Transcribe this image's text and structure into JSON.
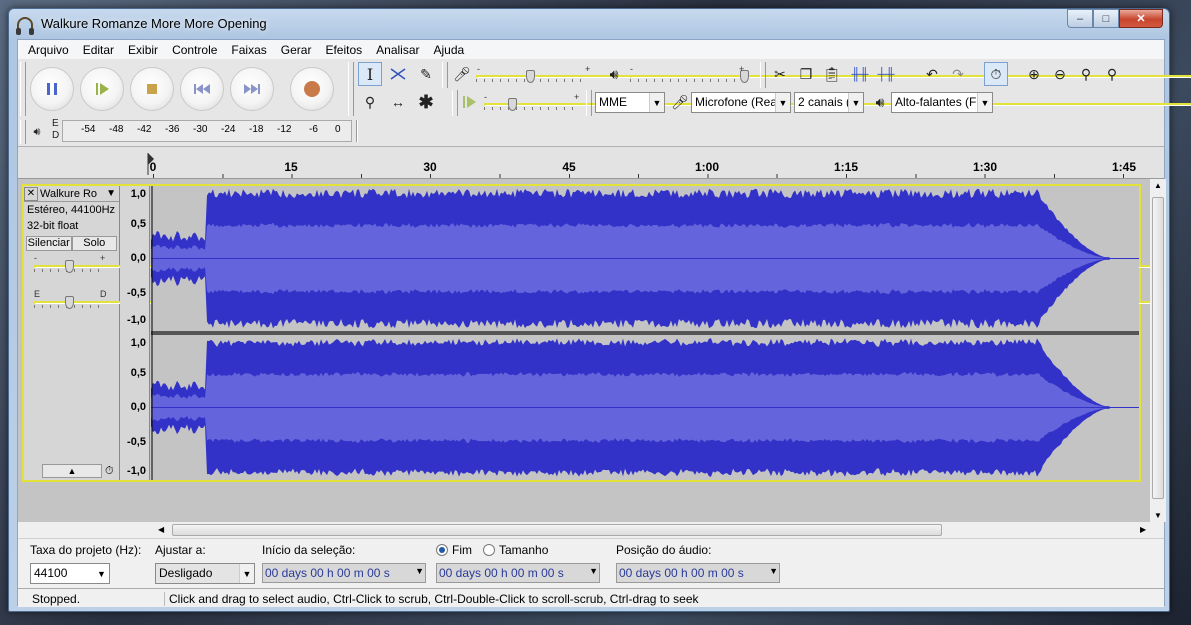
{
  "window": {
    "title": "Walkure Romanze More  More Opening",
    "minimize": "–",
    "maximize": "□",
    "close": "✕"
  },
  "menu": [
    "Arquivo",
    "Editar",
    "Exibir",
    "Controle",
    "Faixas",
    "Gerar",
    "Efeitos",
    "Analisar",
    "Ajuda"
  ],
  "toolbar": {
    "rec_slider_minus": "-",
    "rec_slider_plus": "+",
    "play_slider_minus": "-",
    "play_slider_plus": "+",
    "speed_minus": "-",
    "speed_plus": "+",
    "host": "MME",
    "input_device": "Microfone (Rea",
    "channels": "2 canais (",
    "output_device": "Alto-falantes (F",
    "meter_left": "E",
    "meter_right": "D",
    "meter_ticks": [
      "-54",
      "-48",
      "-42",
      "-36",
      "-30",
      "-24",
      "-18",
      "-12",
      "-6",
      "0"
    ]
  },
  "ruler": {
    "labels": [
      "0",
      "15",
      "30",
      "45",
      "1:00",
      "1:15",
      "1:30",
      "1:45"
    ]
  },
  "track": {
    "name": "Walkure Ro",
    "format": "Estéreo, 44100Hz",
    "sample": "32-bit float",
    "mute": "Silenciar",
    "solo": "Solo",
    "gain_minus": "-",
    "gain_plus": "+",
    "pan_left": "E",
    "pan_right": "D",
    "scale": [
      "1,0",
      "0,5",
      "0,0",
      "-0,5",
      "-1,0"
    ],
    "wave_color": "#3232c8",
    "wave_rms_color": "#6464dc"
  },
  "bottom": {
    "rate_label": "Taxa do projeto (Hz):",
    "rate_value": "44100",
    "snap_label": "Ajustar a:",
    "snap_value": "Desligado",
    "sel_start_label": "Início da seleção:",
    "end_label": "Fim",
    "length_label": "Tamanho",
    "audio_pos_label": "Posição do áudio:",
    "time1": "00 days 00 h 00 m 00 s",
    "time2": "00 days 00 h 00 m 00 s",
    "time3": "00 days 00 h 00 m 00 s"
  },
  "status": {
    "state": "Stopped.",
    "hint": "Click and drag to select audio, Ctrl-Click to scrub, Ctrl-Double-Click to scroll-scrub, Ctrl-drag to seek"
  }
}
